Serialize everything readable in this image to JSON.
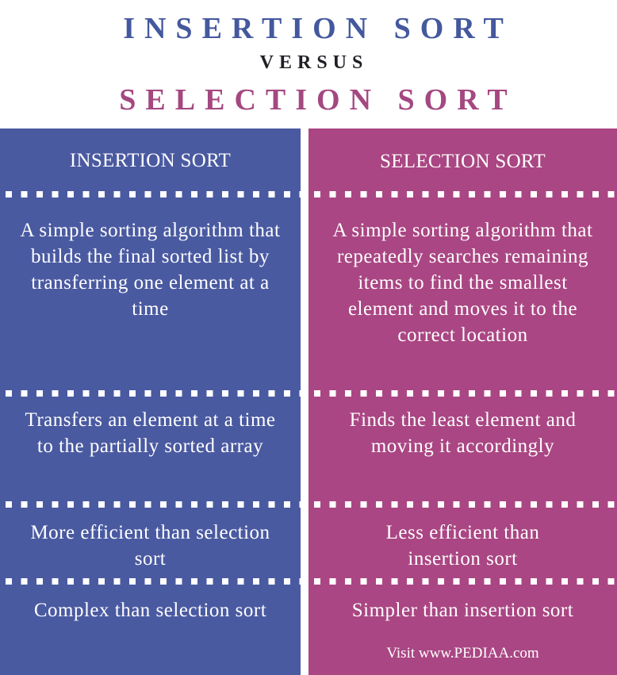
{
  "header": {
    "title_left": "INSERTION SORT",
    "versus": "VERSUS",
    "title_right": "SELECTION SORT"
  },
  "colors": {
    "insertion": "#4A5AA1",
    "selection": "#AA4683",
    "insertion_title": "#44589E",
    "selection_title": "#A44880"
  },
  "columns": [
    {
      "heading": "INSERTION SORT",
      "rows": [
        "A simple sorting algorithm that builds the final sorted list by transferring one element at a time",
        "Transfers an element at a time to the partially sorted array",
        "More efficient than selection sort",
        "Complex than selection sort"
      ]
    },
    {
      "heading": "SELECTION SORT",
      "rows": [
        "A simple sorting algorithm that repeatedly searches remaining items to find the smallest element and moves it to the correct location",
        "Finds the least element and moving it accordingly",
        "Less efficient than insertion sort",
        "Simpler than insertion sort"
      ]
    }
  ],
  "footer": "Visit www.PEDIAA.com"
}
